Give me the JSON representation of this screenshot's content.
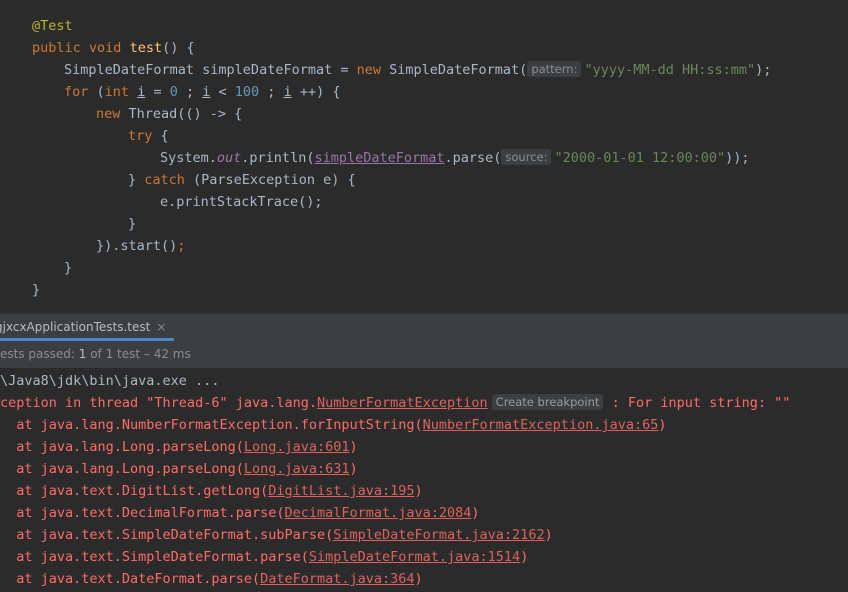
{
  "editor": {
    "annotation": "@Test",
    "kw_public": "public",
    "kw_void": "void",
    "method_name": "test",
    "line2_rest": "() {",
    "l3_type": "SimpleDateFormat simpleDateFormat = ",
    "kw_new": "new",
    "l3_ctor": " SimpleDateFormat(",
    "hint_pattern": "pattern:",
    "l3_str": "\"yyyy-MM-dd HH:ss:mm\"",
    "l3_end": ");",
    "kw_for": "for",
    "l4_a": " (",
    "kw_int": "int",
    "var_i": "i",
    "l4_b": " = ",
    "num_0": "0",
    "l4_c": " ; ",
    "l4_d": " < ",
    "num_100": "100",
    "l4_e": " ++) {",
    "l5_rest": " Thread(() -> {",
    "kw_try": "try",
    "l6_rest": " {",
    "l7_a": "System.",
    "l7_out": "out",
    "l7_b": ".println(",
    "l7_field": "simpleDateFormat",
    "l7_c": ".parse(",
    "hint_source": "source:",
    "l7_str": "\"2000-01-01 12:00:00\"",
    "l7_end": "));",
    "l8_a": "} ",
    "kw_catch": "catch",
    "l8_b": " (ParseException e) {",
    "l9": "e.printStackTrace();",
    "l10": "}",
    "l11_a": "}).start()",
    "l11_semi": ";",
    "l12": "}",
    "l13": "}"
  },
  "run_panel": {
    "tab_label": "gjxcxApplicationTests.test",
    "tab_close": "×",
    "status_prefix": "ests passed: ",
    "status_count": "1",
    "status_suffix": " of 1 test – 42 ms"
  },
  "console": {
    "cmd": "\\Java8\\jdk\\bin\\java.exe ...",
    "exc_prefix": "ception in thread \"Thread-6\" java.lang.",
    "exc_class": "NumberFormatException",
    "breakpoint": "Create breakpoint",
    "exc_suffix": " : For input string: \"\"",
    "frames": [
      {
        "text": "  at java.lang.NumberFormatException.forInputString(",
        "link": "NumberFormatException.java:65",
        "end": ")"
      },
      {
        "text": "  at java.lang.Long.parseLong(",
        "link": "Long.java:601",
        "end": ")"
      },
      {
        "text": "  at java.lang.Long.parseLong(",
        "link": "Long.java:631",
        "end": ")"
      },
      {
        "text": "  at java.text.DigitList.getLong(",
        "link": "DigitList.java:195",
        "end": ")"
      },
      {
        "text": "  at java.text.DecimalFormat.parse(",
        "link": "DecimalFormat.java:2084",
        "end": ")"
      },
      {
        "text": "  at java.text.SimpleDateFormat.subParse(",
        "link": "SimpleDateFormat.java:2162",
        "end": ")"
      },
      {
        "text": "  at java.text.SimpleDateFormat.parse(",
        "link": "SimpleDateFormat.java:1514",
        "end": ")"
      },
      {
        "text": "  at java.text.DateFormat.parse(",
        "link": "DateFormat.java:364",
        "end": ")"
      }
    ]
  }
}
